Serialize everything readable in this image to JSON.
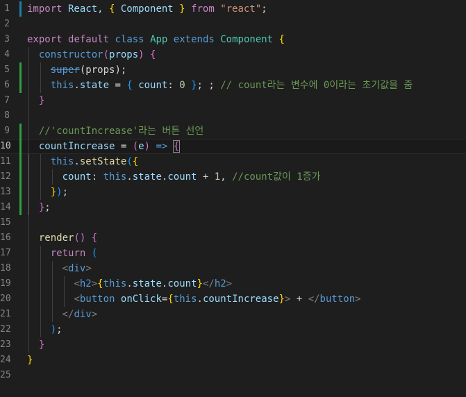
{
  "editor": {
    "language": "javascript-react",
    "lines": [
      {
        "n": "1",
        "tokens": [
          {
            "t": "import",
            "c": "ctl"
          },
          {
            "t": " React, ",
            "c": "var"
          },
          {
            "t": "{",
            "c": "b1"
          },
          {
            "t": " Component ",
            "c": "var"
          },
          {
            "t": "}",
            "c": "b1"
          },
          {
            "t": " ",
            "c": "pl"
          },
          {
            "t": "from",
            "c": "ctl"
          },
          {
            "t": " ",
            "c": "pl"
          },
          {
            "t": "\"react\"",
            "c": "str"
          },
          {
            "t": ";",
            "c": "pl"
          }
        ]
      },
      {
        "n": "2",
        "tokens": []
      },
      {
        "n": "3",
        "tokens": [
          {
            "t": "export",
            "c": "ctl"
          },
          {
            "t": " ",
            "c": "pl"
          },
          {
            "t": "default",
            "c": "ctl"
          },
          {
            "t": " ",
            "c": "pl"
          },
          {
            "t": "class",
            "c": "kw"
          },
          {
            "t": " ",
            "c": "pl"
          },
          {
            "t": "App",
            "c": "cls"
          },
          {
            "t": " ",
            "c": "pl"
          },
          {
            "t": "extends",
            "c": "kw"
          },
          {
            "t": " ",
            "c": "pl"
          },
          {
            "t": "Component",
            "c": "cls"
          },
          {
            "t": " ",
            "c": "pl"
          },
          {
            "t": "{",
            "c": "b1"
          }
        ]
      },
      {
        "n": "4",
        "tokens": [
          {
            "t": "  ",
            "c": "pl"
          },
          {
            "t": "constructor",
            "c": "kw"
          },
          {
            "t": "(",
            "c": "b2"
          },
          {
            "t": "props",
            "c": "var"
          },
          {
            "t": ")",
            "c": "b2"
          },
          {
            "t": " ",
            "c": "pl"
          },
          {
            "t": "{",
            "c": "b2"
          }
        ]
      },
      {
        "n": "5",
        "tokens": [
          {
            "t": "    ",
            "c": "pl"
          },
          {
            "t": "super",
            "c": "kw strike"
          },
          {
            "t": "(props);",
            "c": "pl"
          }
        ]
      },
      {
        "n": "6",
        "tokens": [
          {
            "t": "    ",
            "c": "pl"
          },
          {
            "t": "this",
            "c": "kw"
          },
          {
            "t": ".",
            "c": "pl"
          },
          {
            "t": "state",
            "c": "var"
          },
          {
            "t": " = ",
            "c": "pl"
          },
          {
            "t": "{",
            "c": "b3"
          },
          {
            "t": " ",
            "c": "pl"
          },
          {
            "t": "count",
            "c": "var"
          },
          {
            "t": ": ",
            "c": "pl"
          },
          {
            "t": "0",
            "c": "num"
          },
          {
            "t": " ",
            "c": "pl"
          },
          {
            "t": "}",
            "c": "b3"
          },
          {
            "t": "; ; ",
            "c": "pl"
          },
          {
            "t": "// count라는 변수에 0이라는 초기값을 줌",
            "c": "cm"
          }
        ]
      },
      {
        "n": "7",
        "tokens": [
          {
            "t": "  ",
            "c": "pl"
          },
          {
            "t": "}",
            "c": "b2"
          }
        ]
      },
      {
        "n": "8",
        "tokens": []
      },
      {
        "n": "9",
        "tokens": [
          {
            "t": "  ",
            "c": "pl"
          },
          {
            "t": "//'countIncrease'라는 버튼 선언",
            "c": "cm"
          }
        ]
      },
      {
        "n": "10",
        "active": true,
        "tokens": [
          {
            "t": "  ",
            "c": "pl"
          },
          {
            "t": "countIncrease",
            "c": "var"
          },
          {
            "t": " = ",
            "c": "pl"
          },
          {
            "t": "(",
            "c": "b2"
          },
          {
            "t": "e",
            "c": "var"
          },
          {
            "t": ")",
            "c": "b2"
          },
          {
            "t": " ",
            "c": "pl"
          },
          {
            "t": "=>",
            "c": "kw"
          },
          {
            "t": " ",
            "c": "pl"
          },
          {
            "t": "{",
            "c": "b2 cursor-box"
          }
        ]
      },
      {
        "n": "11",
        "tokens": [
          {
            "t": "    ",
            "c": "pl"
          },
          {
            "t": "this",
            "c": "kw"
          },
          {
            "t": ".",
            "c": "pl"
          },
          {
            "t": "setState",
            "c": "fn"
          },
          {
            "t": "(",
            "c": "b3"
          },
          {
            "t": "{",
            "c": "b1"
          }
        ]
      },
      {
        "n": "12",
        "tokens": [
          {
            "t": "      ",
            "c": "pl"
          },
          {
            "t": "count",
            "c": "var"
          },
          {
            "t": ": ",
            "c": "pl"
          },
          {
            "t": "this",
            "c": "kw"
          },
          {
            "t": ".",
            "c": "pl"
          },
          {
            "t": "state",
            "c": "var"
          },
          {
            "t": ".",
            "c": "pl"
          },
          {
            "t": "count",
            "c": "var"
          },
          {
            "t": " + ",
            "c": "pl"
          },
          {
            "t": "1",
            "c": "num"
          },
          {
            "t": ", ",
            "c": "pl"
          },
          {
            "t": "//count값이 1증가",
            "c": "cm"
          }
        ]
      },
      {
        "n": "13",
        "tokens": [
          {
            "t": "    ",
            "c": "pl"
          },
          {
            "t": "}",
            "c": "b1"
          },
          {
            "t": ")",
            "c": "b3"
          },
          {
            "t": ";",
            "c": "pl"
          }
        ]
      },
      {
        "n": "14",
        "tokens": [
          {
            "t": "  ",
            "c": "pl"
          },
          {
            "t": "}",
            "c": "b2"
          },
          {
            "t": ";",
            "c": "pl"
          }
        ]
      },
      {
        "n": "15",
        "tokens": []
      },
      {
        "n": "16",
        "tokens": [
          {
            "t": "  ",
            "c": "pl"
          },
          {
            "t": "render",
            "c": "fn"
          },
          {
            "t": "()",
            "c": "b2"
          },
          {
            "t": " ",
            "c": "pl"
          },
          {
            "t": "{",
            "c": "b2"
          }
        ]
      },
      {
        "n": "17",
        "tokens": [
          {
            "t": "    ",
            "c": "pl"
          },
          {
            "t": "return",
            "c": "ctl"
          },
          {
            "t": " ",
            "c": "pl"
          },
          {
            "t": "(",
            "c": "b3"
          }
        ]
      },
      {
        "n": "18",
        "tokens": [
          {
            "t": "      ",
            "c": "pl"
          },
          {
            "t": "<",
            "c": "ang"
          },
          {
            "t": "div",
            "c": "tag"
          },
          {
            "t": ">",
            "c": "ang"
          }
        ]
      },
      {
        "n": "19",
        "tokens": [
          {
            "t": "        ",
            "c": "pl"
          },
          {
            "t": "<",
            "c": "ang"
          },
          {
            "t": "h2",
            "c": "tag"
          },
          {
            "t": ">",
            "c": "ang"
          },
          {
            "t": "{",
            "c": "b1"
          },
          {
            "t": "this",
            "c": "kw"
          },
          {
            "t": ".",
            "c": "pl"
          },
          {
            "t": "state",
            "c": "var"
          },
          {
            "t": ".",
            "c": "pl"
          },
          {
            "t": "count",
            "c": "var"
          },
          {
            "t": "}",
            "c": "b1"
          },
          {
            "t": "</",
            "c": "ang"
          },
          {
            "t": "h2",
            "c": "tag"
          },
          {
            "t": ">",
            "c": "ang"
          }
        ]
      },
      {
        "n": "20",
        "tokens": [
          {
            "t": "        ",
            "c": "pl"
          },
          {
            "t": "<",
            "c": "ang"
          },
          {
            "t": "button",
            "c": "tag"
          },
          {
            "t": " ",
            "c": "pl"
          },
          {
            "t": "onClick",
            "c": "attr"
          },
          {
            "t": "=",
            "c": "pl"
          },
          {
            "t": "{",
            "c": "b1"
          },
          {
            "t": "this",
            "c": "kw"
          },
          {
            "t": ".",
            "c": "pl"
          },
          {
            "t": "countIncrease",
            "c": "var"
          },
          {
            "t": "}",
            "c": "b1"
          },
          {
            "t": ">",
            "c": "ang"
          },
          {
            "t": " + ",
            "c": "pl"
          },
          {
            "t": "</",
            "c": "ang"
          },
          {
            "t": "button",
            "c": "tag"
          },
          {
            "t": ">",
            "c": "ang"
          }
        ]
      },
      {
        "n": "21",
        "tokens": [
          {
            "t": "      ",
            "c": "pl"
          },
          {
            "t": "</",
            "c": "ang"
          },
          {
            "t": "div",
            "c": "tag"
          },
          {
            "t": ">",
            "c": "ang"
          }
        ]
      },
      {
        "n": "22",
        "tokens": [
          {
            "t": "    ",
            "c": "pl"
          },
          {
            "t": ")",
            "c": "b3"
          },
          {
            "t": ";",
            "c": "pl"
          }
        ]
      },
      {
        "n": "23",
        "tokens": [
          {
            "t": "  ",
            "c": "pl"
          },
          {
            "t": "}",
            "c": "b2"
          }
        ]
      },
      {
        "n": "24",
        "tokens": [
          {
            "t": "}",
            "c": "b1"
          }
        ]
      },
      {
        "n": "25",
        "tokens": []
      }
    ]
  },
  "colors": {
    "background": "#1e1e1e",
    "modified_gutter": "#2ea043",
    "added_gutter": "#1b81a8",
    "indent_guide": "#404040",
    "active_indent_guide": "#707070"
  }
}
